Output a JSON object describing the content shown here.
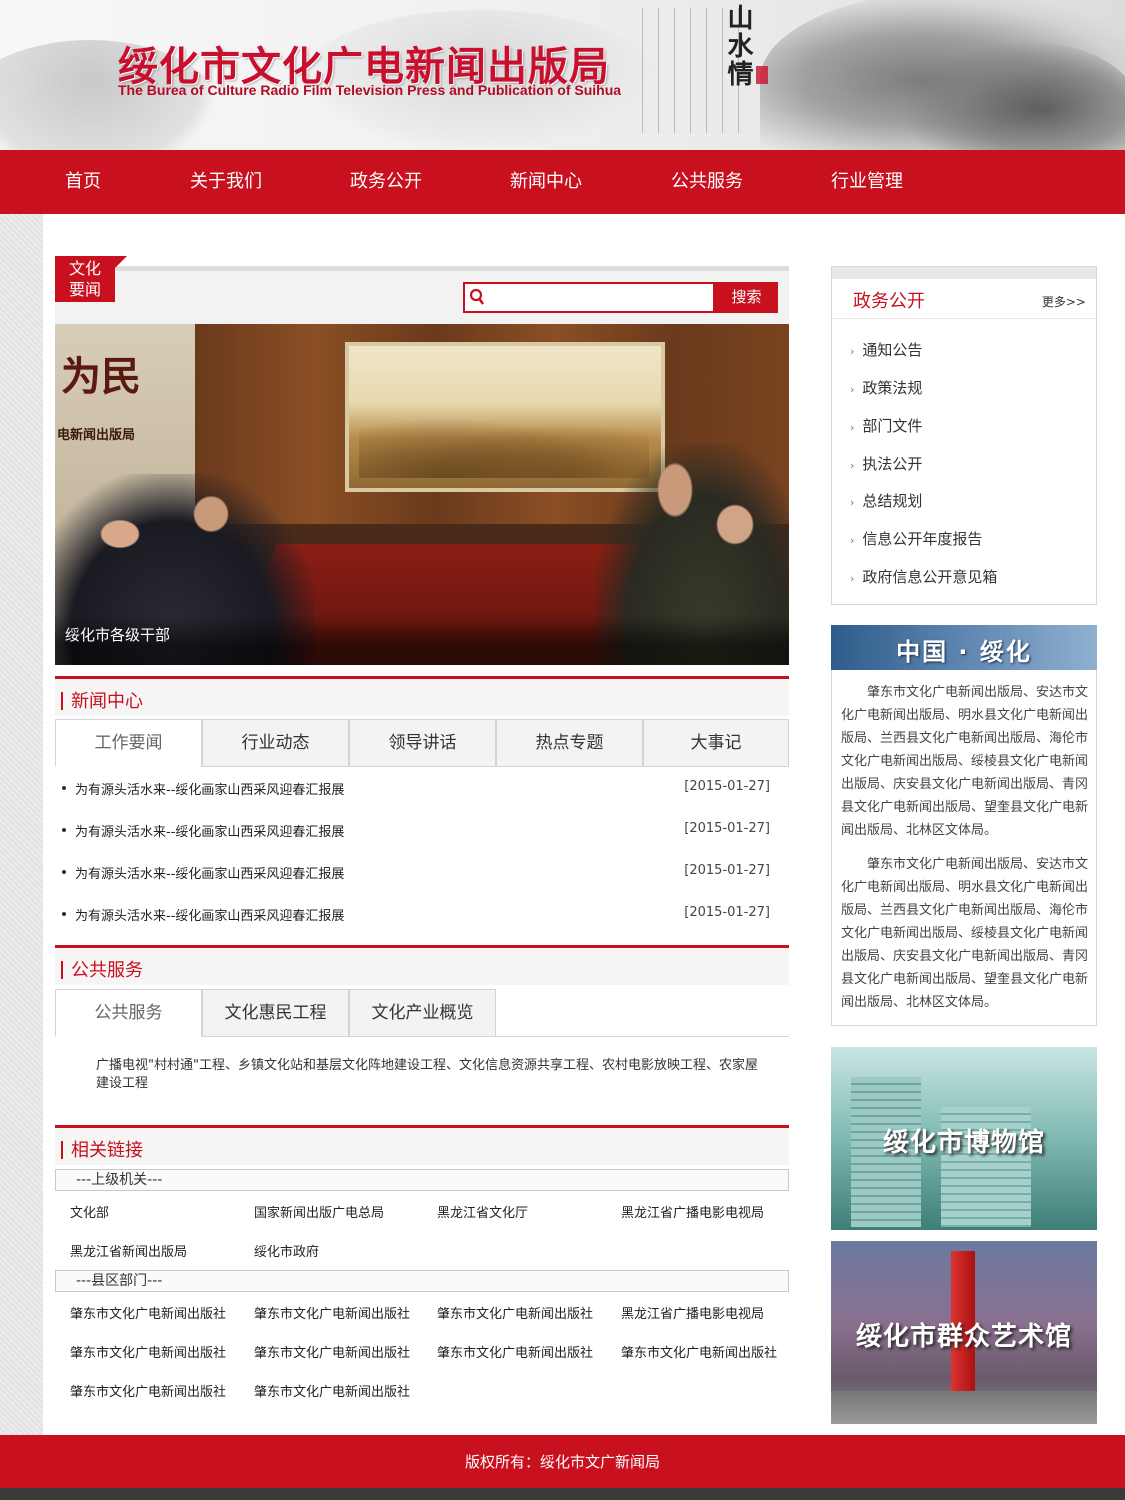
{
  "header": {
    "title": "绥化市文化广电新闻出版局",
    "subtitle": "The Burea of Culture Radio Film Television Press and Publication of Suihua",
    "art_text": "山水情"
  },
  "nav": {
    "items": [
      "首页",
      "关于我们",
      "政务公开",
      "新闻中心",
      "公共服务",
      "行业管理"
    ]
  },
  "news_label": {
    "line1": "文化",
    "line2": "要闻"
  },
  "search": {
    "placeholder": "",
    "button": "搜索"
  },
  "slideshow": {
    "caption": "绥化市各级干部",
    "wall_text": "为民",
    "wall_subtext": "电新闻出版局"
  },
  "news_center": {
    "title": "新闻中心",
    "tabs": [
      "工作要闻",
      "行业动态",
      "领导讲话",
      "热点专题",
      "大事记"
    ],
    "active_tab": "工作要闻",
    "items": [
      {
        "title": "为有源头活水来--绥化画家山西采风迎春汇报展",
        "date": "[2015-01-27]"
      },
      {
        "title": "为有源头活水来--绥化画家山西采风迎春汇报展",
        "date": "[2015-01-27]"
      },
      {
        "title": "为有源头活水来--绥化画家山西采风迎春汇报展",
        "date": "[2015-01-27]"
      },
      {
        "title": "为有源头活水来--绥化画家山西采风迎春汇报展",
        "date": "[2015-01-27]"
      }
    ]
  },
  "public_service": {
    "title": "公共服务",
    "tabs": [
      "公共服务",
      "文化惠民工程",
      "文化产业概览"
    ],
    "active_tab": "公共服务",
    "content": "广播电视\"村村通\"工程、乡镇文化站和基层文化阵地建设工程、文化信息资源共享工程、农村电影放映工程、农家屋建设工程"
  },
  "related_links": {
    "title": "相关链接",
    "groups": [
      {
        "label": "---上级机关---",
        "links": [
          "文化部",
          "国家新闻出版广电总局",
          "黑龙江省文化厅",
          "黑龙江省广播电影电视局",
          "黑龙江省新闻出版局",
          "绥化市政府"
        ]
      },
      {
        "label": "---县区部门---",
        "links": [
          "肇东市文化广电新闻出版社",
          "肇东市文化广电新闻出版社",
          "肇东市文化广电新闻出版社",
          "黑龙江省广播电影电视局",
          "肇东市文化广电新闻出版社",
          "肇东市文化广电新闻出版社",
          "肇东市文化广电新闻出版社",
          "肇东市文化广电新闻出版社",
          "肇东市文化广电新闻出版社",
          "肇东市文化广电新闻出版社"
        ]
      }
    ]
  },
  "sidebar": {
    "gov": {
      "title": "政务公开",
      "more": "更多>>",
      "items": [
        "通知公告",
        "政策法规",
        "部门文件",
        "执法公开",
        "总结规划",
        "信息公开年度报告",
        "政府信息公开意见箱"
      ]
    },
    "banner": "中国 · 绥化",
    "intro": [
      "肇东市文化广电新闻出版局、安达市文化广电新闻出版局、明水县文化广电新闻出版局、兰西县文化广电新闻出版局、海伦市文化广电新闻出版局、绥棱县文化广电新闻出版局、庆安县文化广电新闻出版局、青冈县文化广电新闻出版局、望奎县文化广电新闻出版局、北林区文体局。",
      "肇东市文化广电新闻出版局、安达市文化广电新闻出版局、明水县文化广电新闻出版局、兰西县文化广电新闻出版局、海伦市文化广电新闻出版局、绥棱县文化广电新闻出版局、庆安县文化广电新闻出版局、青冈县文化广电新闻出版局、望奎县文化广电新闻出版局、北林区文体局。"
    ],
    "promos": [
      "绥化市博物馆",
      "绥化市群众艺术馆"
    ]
  },
  "footer": {
    "copyright": "版权所有：绥化市文广新闻局"
  },
  "colors": {
    "brand_red": "#c8101f",
    "background": "#e6e6e6"
  }
}
